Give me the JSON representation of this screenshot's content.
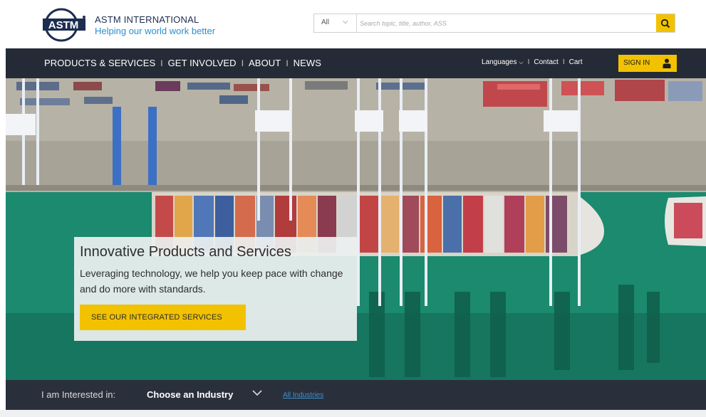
{
  "brand": {
    "name": "ASTM INTERNATIONAL",
    "tagline": "Helping our world work better",
    "logo_text": "ASTM"
  },
  "search": {
    "scope": "All",
    "placeholder": "Search topic, title, author, ASS"
  },
  "nav": {
    "items": [
      {
        "label": "PRODUCTS & SERVICES"
      },
      {
        "label": "GET INVOLVED"
      },
      {
        "label": "ABOUT"
      },
      {
        "label": "NEWS"
      }
    ],
    "separator": "I",
    "languages": "Languages",
    "contact": "Contact",
    "cart": "Cart",
    "signin": "SIGN IN"
  },
  "hero": {
    "title": "Innovative Products and Services",
    "body": "Leveraging technology, we help you keep pace with change and do more with standards.",
    "cta": "SEE OUR INTEGRATED SERVICES"
  },
  "interest": {
    "label": "I am Interested in:",
    "select": "Choose an Industry",
    "link": "All Industries"
  },
  "colors": {
    "accent": "#f2c200",
    "navbar": "#252b36",
    "water": "#1a8a70",
    "brand_blue": "#2a8fd0"
  },
  "icons": [
    "search-icon",
    "user-icon",
    "chevron-down-icon",
    "astm-logo"
  ]
}
